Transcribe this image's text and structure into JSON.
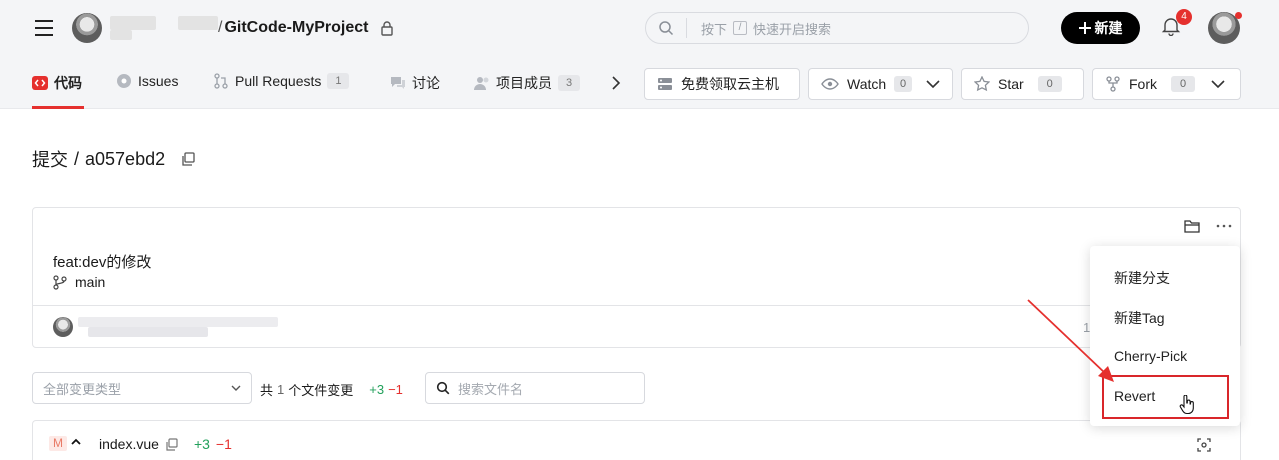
{
  "header": {
    "repo_name": "GitCode-MyProject",
    "search_placeholder_prefix": "按下",
    "search_key": "/",
    "search_placeholder_suffix": "快速开启搜索",
    "new_button": "新建",
    "notification_count": "4"
  },
  "nav": {
    "tabs": [
      {
        "label": "代码"
      },
      {
        "label": "Issues"
      },
      {
        "label": "Pull Requests",
        "count": "1"
      },
      {
        "label": "讨论"
      },
      {
        "label": "项目成员",
        "count": "3"
      }
    ],
    "cloud_host": "免费领取云主机",
    "watch": {
      "label": "Watch",
      "count": "0"
    },
    "star": {
      "label": "Star",
      "count": "0"
    },
    "fork": {
      "label": "Fork",
      "count": "0"
    }
  },
  "commit": {
    "title_prefix": "提交",
    "hash": "a057ebd2",
    "message": "feat:dev的修改",
    "branch": "main",
    "truncated_text": "1"
  },
  "filters": {
    "change_type_placeholder": "全部变更类型",
    "summary_prefix": "共",
    "file_count": "1",
    "summary_suffix": "个文件变更",
    "additions": "+3",
    "deletions": "−1",
    "file_search_placeholder": "搜索文件名"
  },
  "file": {
    "status": "M",
    "name": "index.vue",
    "additions": "+3",
    "deletions": "−1"
  },
  "dropdown_menu": {
    "items": [
      "新建分支",
      "新建Tag",
      "Cherry-Pick",
      "Revert"
    ]
  },
  "colors": {
    "accent_red": "#e5302e",
    "addition_green": "#22a05b"
  }
}
